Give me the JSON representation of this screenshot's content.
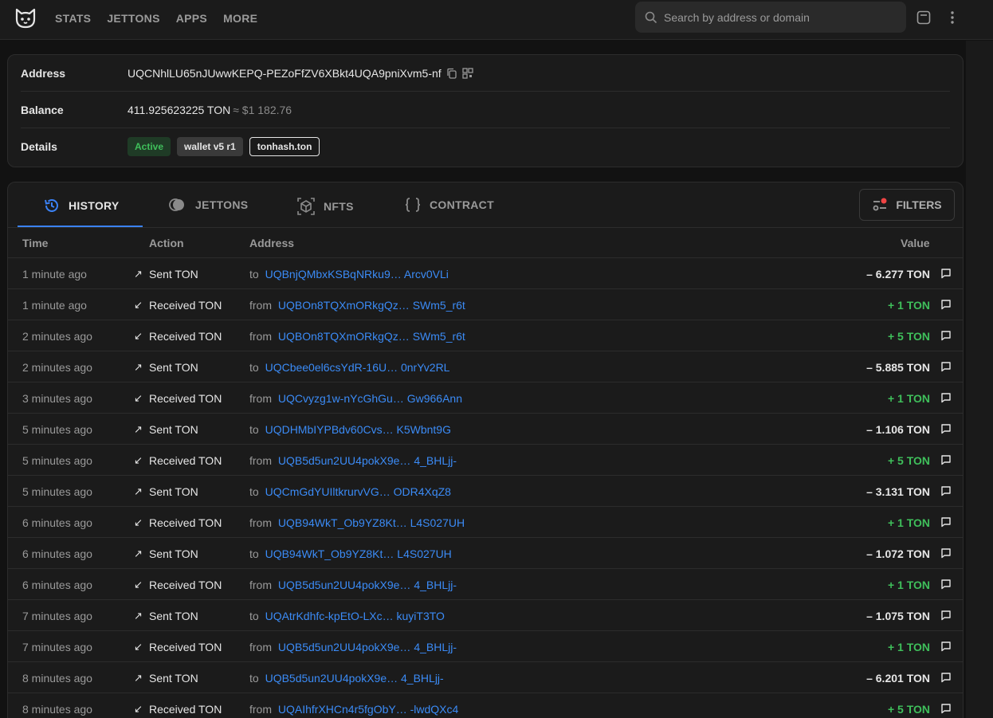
{
  "nav": [
    "STATS",
    "JETTONS",
    "APPS",
    "MORE"
  ],
  "search": {
    "placeholder": "Search by address or domain"
  },
  "address": {
    "label": "Address",
    "value": "UQCNhlLU65nJUwwKEPQ-PEZoFfZV6XBkt4UQA9pniXvm5-nf"
  },
  "balance": {
    "label": "Balance",
    "ton": "411.925623225 TON",
    "usd": "≈ $1 182.76"
  },
  "details": {
    "label": "Details",
    "status": "Active",
    "wallet": "wallet v5 r1",
    "domain": "tonhash.ton"
  },
  "tabs": [
    "HISTORY",
    "JETTONS",
    "NFTS",
    "CONTRACT"
  ],
  "filters_label": "FILTERS",
  "columns": {
    "time": "Time",
    "action": "Action",
    "address": "Address",
    "value": "Value"
  },
  "colors": {
    "accent": "#3b82f6",
    "positive": "#3fbf5b",
    "filter_dot": "#ef4444"
  },
  "rows": [
    {
      "time": "1 minute ago",
      "action": "Sent TON",
      "dir": "to",
      "addr": "UQBnjQMbxKSBqNRku9…  Arcv0VLi",
      "value": "– 6.277 TON",
      "sign": "neg"
    },
    {
      "time": "1 minute ago",
      "action": "Received TON",
      "dir": "from",
      "addr": "UQBOn8TQXmORkgQz…  SWm5_r6t",
      "value": "+ 1 TON",
      "sign": "pos"
    },
    {
      "time": "2 minutes ago",
      "action": "Received TON",
      "dir": "from",
      "addr": "UQBOn8TQXmORkgQz…  SWm5_r6t",
      "value": "+ 5 TON",
      "sign": "pos"
    },
    {
      "time": "2 minutes ago",
      "action": "Sent TON",
      "dir": "to",
      "addr": "UQCbee0el6csYdR-16U… 0nrYv2RL",
      "value": "– 5.885 TON",
      "sign": "neg"
    },
    {
      "time": "3 minutes ago",
      "action": "Received TON",
      "dir": "from",
      "addr": "UQCvyzg1w-nYcGhGu… Gw966Ann",
      "value": "+ 1 TON",
      "sign": "pos"
    },
    {
      "time": "5 minutes ago",
      "action": "Sent TON",
      "dir": "to",
      "addr": "UQDHMbIYPBdv60Cvs…  K5Wbnt9G",
      "value": "– 1.106 TON",
      "sign": "neg"
    },
    {
      "time": "5 minutes ago",
      "action": "Received TON",
      "dir": "from",
      "addr": "UQB5d5un2UU4pokX9e… 4_BHLjj-",
      "value": "+ 5 TON",
      "sign": "pos"
    },
    {
      "time": "5 minutes ago",
      "action": "Sent TON",
      "dir": "to",
      "addr": "UQCmGdYUIltkrurvVG…  ODR4XqZ8",
      "value": "– 3.131 TON",
      "sign": "neg"
    },
    {
      "time": "6 minutes ago",
      "action": "Received TON",
      "dir": "from",
      "addr": "UQB94WkT_Ob9YZ8Kt… L4S027UH",
      "value": "+ 1 TON",
      "sign": "pos"
    },
    {
      "time": "6 minutes ago",
      "action": "Sent TON",
      "dir": "to",
      "addr": "UQB94WkT_Ob9YZ8Kt… L4S027UH",
      "value": "– 1.072 TON",
      "sign": "neg"
    },
    {
      "time": "6 minutes ago",
      "action": "Received TON",
      "dir": "from",
      "addr": "UQB5d5un2UU4pokX9e… 4_BHLjj-",
      "value": "+ 1 TON",
      "sign": "pos"
    },
    {
      "time": "7 minutes ago",
      "action": "Sent TON",
      "dir": "to",
      "addr": "UQAtrKdhfc-kpEtO-LXc…  kuyiT3TO",
      "value": "– 1.075 TON",
      "sign": "neg"
    },
    {
      "time": "7 minutes ago",
      "action": "Received TON",
      "dir": "from",
      "addr": "UQB5d5un2UU4pokX9e… 4_BHLjj-",
      "value": "+ 1 TON",
      "sign": "pos"
    },
    {
      "time": "8 minutes ago",
      "action": "Sent TON",
      "dir": "to",
      "addr": "UQB5d5un2UU4pokX9e… 4_BHLjj-",
      "value": "– 6.201 TON",
      "sign": "neg"
    },
    {
      "time": "8 minutes ago",
      "action": "Received TON",
      "dir": "from",
      "addr": "UQAIhfrXHCn4r5fgObY…  -lwdQXc4",
      "value": "+ 5 TON",
      "sign": "pos"
    }
  ]
}
